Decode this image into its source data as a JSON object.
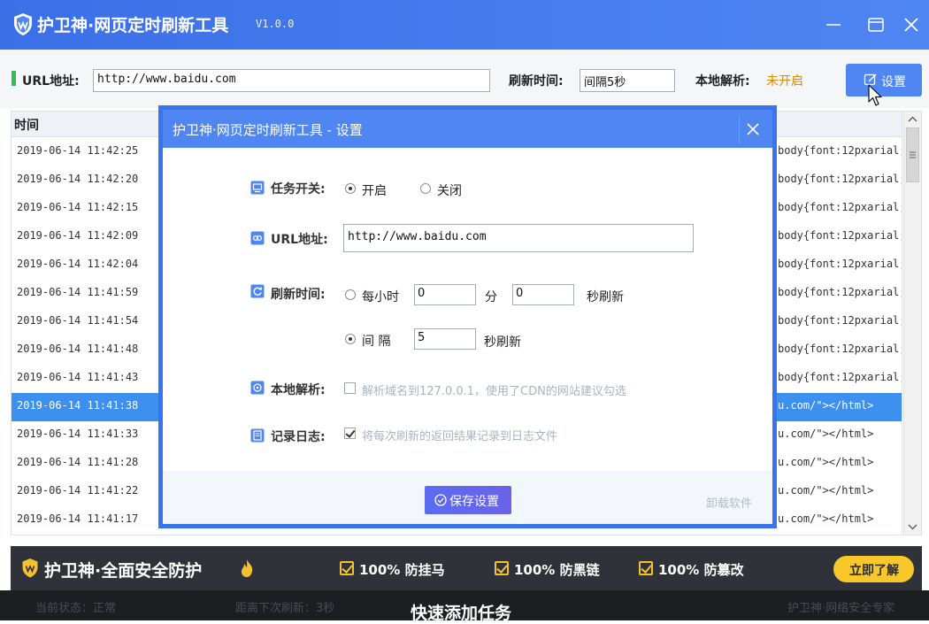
{
  "app": {
    "title": "护卫神·网页定时刷新工具",
    "version": "V1.0.0",
    "logo_icon": "shield-logo-icon",
    "window_buttons": [
      "minimize-icon",
      "maximize-icon",
      "close-icon"
    ]
  },
  "toolbar": {
    "url_label": "URL地址:",
    "url_value": "http://www.baidu.com",
    "refresh_label": "刷新时间:",
    "refresh_value": "间隔5秒",
    "dns_label": "本地解析:",
    "dns_status": "未开启",
    "settings_button": "设置"
  },
  "list": {
    "header_time": "时间",
    "rows": [
      {
        "time": "2019-06-14 11:42:25",
        "content": "body{font:12pxarial;"
      },
      {
        "time": "2019-06-14 11:42:20",
        "content": "body{font:12pxarial;"
      },
      {
        "time": "2019-06-14 11:42:15",
        "content": "body{font:12pxarial;"
      },
      {
        "time": "2019-06-14 11:42:09",
        "content": "body{font:12pxarial;"
      },
      {
        "time": "2019-06-14 11:42:04",
        "content": "body{font:12pxarial;"
      },
      {
        "time": "2019-06-14 11:41:59",
        "content": "body{font:12pxarial;"
      },
      {
        "time": "2019-06-14 11:41:54",
        "content": "body{font:12pxarial;"
      },
      {
        "time": "2019-06-14 11:41:48",
        "content": "body{font:12pxarial;"
      },
      {
        "time": "2019-06-14 11:41:43",
        "content": "body{font:12pxarial;"
      },
      {
        "time": "2019-06-14 11:41:38",
        "content": "u.com/\"></html>",
        "selected": true
      },
      {
        "time": "2019-06-14 11:41:33",
        "content": "u.com/\"></html>"
      },
      {
        "time": "2019-06-14 11:41:28",
        "content": "u.com/\"></html>"
      },
      {
        "time": "2019-06-14 11:41:22",
        "content": "u.com/\"></html>"
      },
      {
        "time": "2019-06-14 11:41:17",
        "content": "u.com/\"></html>"
      }
    ]
  },
  "modal": {
    "title": "护卫神·网页定时刷新工具 - 设置",
    "task_switch": {
      "label": "任务开关:",
      "on_label": "开启",
      "off_label": "关闭",
      "selected": "on"
    },
    "url": {
      "label": "URL地址:",
      "value": "http://www.baidu.com"
    },
    "refresh": {
      "label": "刷新时间:",
      "hourly_label": "每小时",
      "minute_value": "0",
      "minute_unit": "分",
      "second_value": "0",
      "second_unit": "秒刷新",
      "interval_label": "间 隔",
      "interval_value": "5",
      "interval_unit": "秒刷新",
      "selected": "interval"
    },
    "local_dns": {
      "label": "本地解析:",
      "checkbox_text": "解析域名到127.0.0.1，使用了CDN的网站建议勾选",
      "checked": false
    },
    "log": {
      "label": "记录日志:",
      "checkbox_text": "将每次刷新的返回结果记录到日志文件",
      "checked": true
    },
    "save_button": "保存设置",
    "uninstall_link": "卸载软件"
  },
  "promo": {
    "title": "护卫神·全面安全防护",
    "items": [
      "100% 防挂马",
      "100% 防黑链",
      "100% 防篡改"
    ],
    "button": "立即了解"
  },
  "statusbar": {
    "left": "当前状态：正常",
    "middle": "距离下次刷新：3秒",
    "right": "护卫神·网络安全专家",
    "overlay": "快速添加任务"
  },
  "colors": {
    "title_bar": "#4f86f2",
    "accent_green": "#2fbf5a",
    "dns_status": "#e08a00",
    "selected_row": "#3d8ff0",
    "promo_bg": "#2f3238",
    "promo_button": "#f8c82b",
    "save_button": "#5a6cf2"
  }
}
